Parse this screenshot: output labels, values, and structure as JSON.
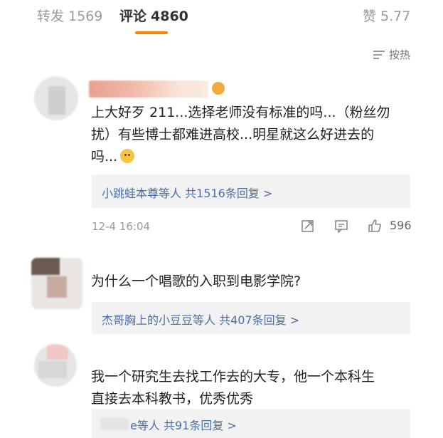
{
  "tabs": {
    "repost": {
      "label": "转发",
      "count": "1569"
    },
    "comments": {
      "label": "评论",
      "count": "4860"
    },
    "likes": {
      "label": "赞",
      "count": "5.77"
    }
  },
  "sort": {
    "label": "按热"
  },
  "comments": [
    {
      "lines": [
        "上大好歹 211...选择老师没有标准的吗...（粉丝勿",
        "扰）有些博士都难进高校...明星就这么好进去的",
        "吗..."
      ],
      "reply_names": "小跳蛙本尊",
      "reply_suffix": "等人",
      "reply_count": "共1516条回复 >",
      "time": "12-4 16:04",
      "likes": "596"
    },
    {
      "lines": [
        "为什么一个唱歌的入职到电影学院?"
      ],
      "reply_names": "杰哥胸上的小豆豆",
      "reply_suffix": "等人",
      "reply_count": "共407条回复 >"
    },
    {
      "lines": [
        "我一个研究生去找工作去的大专，他一个本科生",
        "直接去本科教书，优秀优秀"
      ],
      "reply_names": "e",
      "reply_suffix": "等人",
      "reply_count": "共91条回复 >"
    }
  ],
  "colors": {
    "accent": "#ff8200",
    "link": "#4a6fa5",
    "reply_bg": "#f2f2f2"
  }
}
